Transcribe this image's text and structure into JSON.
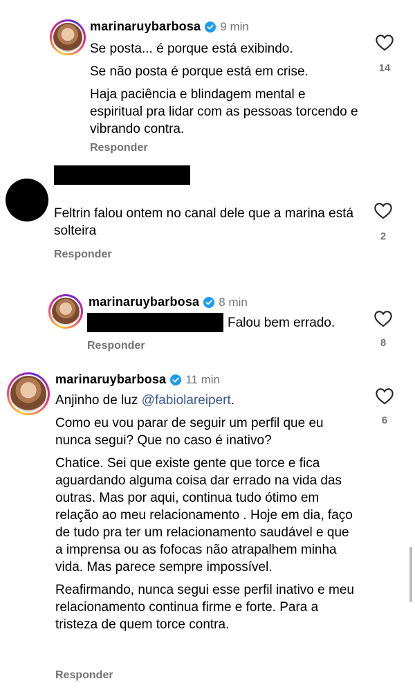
{
  "comments": [
    {
      "username": "marinaruybarbosa",
      "verified": true,
      "time": "9 min",
      "paragraphs": [
        "Se posta... é porque está exibindo.",
        "Se não posta é porque está em crise.",
        "Haja paciência e blindagem mental e espiritual pra lidar com as pessoas torcendo e vibrando contra."
      ],
      "reply_label": "Responder",
      "likes": "14"
    },
    {
      "username": "",
      "time": "",
      "paragraphs": [
        "Feltrin falou ontem no canal dele que a marina está solteira"
      ],
      "reply_label": "Responder",
      "likes": "2"
    },
    {
      "username": "marinaruybarbosa",
      "verified": true,
      "time": "8 min",
      "paragraphs": [
        "Falou bem errado."
      ],
      "reply_label": "Responder",
      "likes": "8"
    },
    {
      "username": "marinaruybarbosa",
      "verified": true,
      "time": "11 min",
      "first_line_text": "Anjinho de luz ",
      "mention": "@fabiolareipert",
      "first_line_end": ".",
      "paragraphs": [
        "Como eu vou parar de seguir um perfil que eu nunca segui? Que no caso é inativo?",
        "Chatice. Sei que existe gente que torce e fica aguardando alguma coisa dar errado na vida das outras. Mas por aqui, continua tudo ótimo em relação ao meu relacionamento . Hoje em dia, faço de tudo pra ter um relacionamento saudável e que a imprensa ou as fofocas não atrapalhem minha vida. Mas parece sempre impossível.",
        "Reafirmando, nunca segui esse perfil inativo e meu relacionamento continua firme e forte. Para a tristeza de quem torce contra."
      ],
      "reply_label": "Responder",
      "likes": "6"
    }
  ],
  "icons": {
    "like": "heart-outline-icon",
    "verified": "verified-badge-icon"
  },
  "colors": {
    "secondary_text": "#737373",
    "verified": "#1d9bf0",
    "mention": "#385898"
  }
}
